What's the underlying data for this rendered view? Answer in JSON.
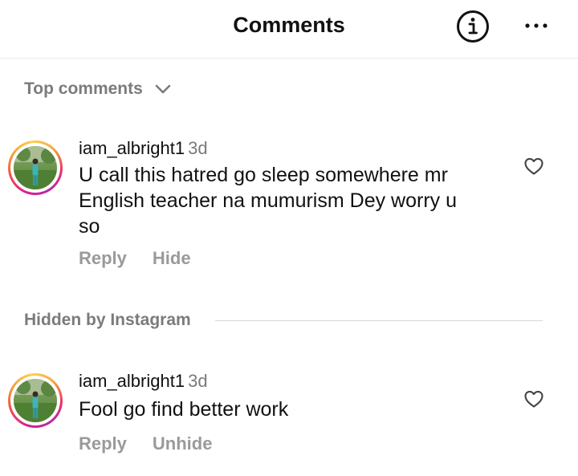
{
  "header": {
    "title": "Comments",
    "info_icon": "info-circle-icon",
    "more_icon": "more-horizontal-icon"
  },
  "sort": {
    "label": "Top comments",
    "icon": "chevron-down-icon"
  },
  "comments": [
    {
      "username": "iam_albright1",
      "time": "3d",
      "lines": [
        "U call this hatred  go sleep somewhere mr",
        "English teacher na mumurism Dey worry u",
        "so"
      ],
      "reply_label": "Reply",
      "action_label": "Hide",
      "like_icon": "heart-outline-icon"
    }
  ],
  "hidden_section": {
    "label": "Hidden by Instagram",
    "comments": [
      {
        "username": "iam_albright1",
        "time": "3d",
        "lines": [
          "Fool go find better work"
        ],
        "reply_label": "Reply",
        "action_label": "Unhide",
        "like_icon": "heart-outline-icon"
      }
    ]
  },
  "colors": {
    "primary_text": "#111111",
    "secondary_text": "#7b7b7b",
    "action_text": "#9a9a9a",
    "divider": "#d8d8d8",
    "story_ring": [
      "#d8208f",
      "#f24d4b",
      "#f7a23a",
      "#f9d153"
    ]
  }
}
